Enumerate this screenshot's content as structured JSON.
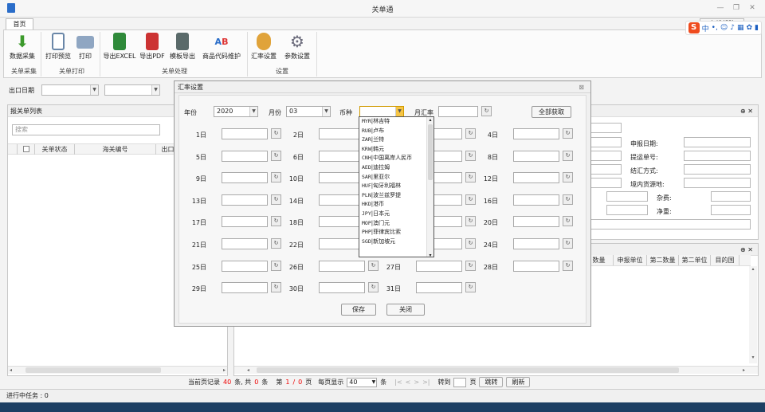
{
  "app": {
    "title": "关单通",
    "tab_home": "首页",
    "assist_label": "在线帮助"
  },
  "ribbon": {
    "buttons": [
      {
        "label": "数据采集",
        "icon": "download-arrow-icon",
        "color": "#3c9a2c"
      },
      {
        "label": "打印预览",
        "icon": "print-preview-icon",
        "color": "#6a87a8"
      },
      {
        "label": "打印",
        "icon": "printer-icon",
        "color": "#6a87a8"
      },
      {
        "label": "导出EXCEL",
        "icon": "excel-export-icon",
        "color": "#2f8a3a"
      },
      {
        "label": "导出PDF",
        "icon": "pdf-export-icon",
        "color": "#c33"
      },
      {
        "label": "模板导出",
        "icon": "template-export-icon",
        "color": "#566"
      },
      {
        "label": "商品代码维护",
        "icon": "ab-code-icon",
        "color": "#2a6dc9"
      },
      {
        "label": "汇率设置",
        "icon": "coins-icon",
        "color": "#d08a1c"
      },
      {
        "label": "参数设置",
        "icon": "gear-icon",
        "color": "#6a6a7a"
      }
    ],
    "groups": [
      "关单采集",
      "关单打印",
      "关单处理",
      "设置"
    ]
  },
  "filter": {
    "export_date_label": "出口日期"
  },
  "left_panel": {
    "title": "报关单列表",
    "search_placeholder": "搜索",
    "columns": [
      "关单状态",
      "海关编号",
      "出口"
    ]
  },
  "right_form": {
    "labels": [
      "申报日期:",
      "提运单号:",
      "结汇方式:",
      "境内货源地:",
      "杂费:",
      "净重:"
    ]
  },
  "right_grid": {
    "columns": [
      "数量",
      "申报单位",
      "第二数量",
      "第二单位",
      "目的国"
    ]
  },
  "pager": {
    "prefix": "当前页记录",
    "count": "40",
    "mid1": "条, 共",
    "total": "0",
    "mid2": "条",
    "page_prefix": "第",
    "page": "1",
    "sep": "/",
    "pages": "0",
    "page_suffix": "页",
    "per_page_label": "每页显示",
    "per_page": "40",
    "per_suffix": "条",
    "goto_label": "转到",
    "goto_suffix": "页",
    "jump_btn": "跳转",
    "refresh_btn": "刷新"
  },
  "status": {
    "text": "进行中任务 : 0"
  },
  "dialog": {
    "title": "汇率设置",
    "year_label": "年份",
    "year": "2020",
    "month_label": "月份",
    "month": "03",
    "currency_label": "币种",
    "currency": "",
    "monthly_label": "月汇率",
    "fetch_all": "全部获取",
    "days": [
      "1日",
      "2日",
      "3日",
      "4日",
      "5日",
      "6日",
      "7日",
      "8日",
      "9日",
      "10日",
      "11日",
      "12日",
      "13日",
      "14日",
      "15日",
      "16日",
      "17日",
      "18日",
      "19日",
      "20日",
      "21日",
      "22日",
      "23日",
      "24日",
      "25日",
      "26日",
      "27日",
      "28日",
      "29日",
      "30日",
      "31日"
    ],
    "save": "保存",
    "close": "关闭"
  },
  "dropdown": [
    {
      "code": "MYR",
      "name": "林吉特"
    },
    {
      "code": "RUB",
      "name": "卢布"
    },
    {
      "code": "ZAR",
      "name": "兰特"
    },
    {
      "code": "KRW",
      "name": "韩元"
    },
    {
      "code": "CNH",
      "name": "中国离岸人民币"
    },
    {
      "code": "AED",
      "name": "迪拉姆"
    },
    {
      "code": "SAR",
      "name": "里亚尔"
    },
    {
      "code": "HUF",
      "name": "匈牙利福林"
    },
    {
      "code": "PLN",
      "name": "波兰兹罗提"
    },
    {
      "code": "HKD",
      "name": "港币"
    },
    {
      "code": "JPY",
      "name": "日本元"
    },
    {
      "code": "MOP",
      "name": "澳门元"
    },
    {
      "code": "PHP",
      "name": "菲律宾比索"
    },
    {
      "code": "SGD",
      "name": "新加坡元"
    }
  ]
}
